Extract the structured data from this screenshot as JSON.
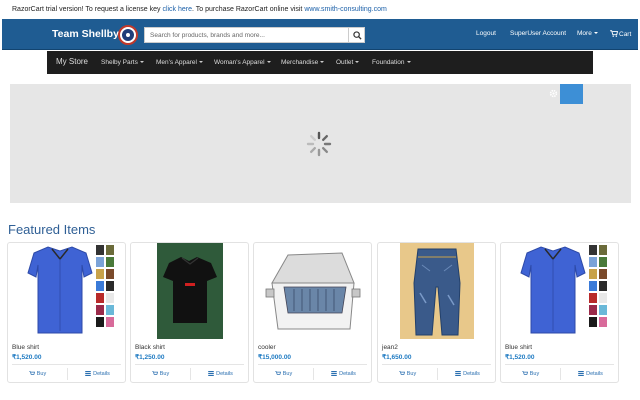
{
  "trial_bar": {
    "text_before": "RazorCart trial version! To request a license key ",
    "link1": "click here",
    "text_middle": ". To purchase RazorCart online visit ",
    "link2": "www.smith-consulting.com"
  },
  "header": {
    "brand": "Team Shellby",
    "search_placeholder": "Search for products, brands and more...",
    "logout": "Logout",
    "account": "SuperUser Account",
    "more": "More",
    "cart": "Cart"
  },
  "category_nav": {
    "store": "My Store",
    "items": [
      "Shelby Parts",
      "Men's Apparel",
      "Woman's Apparel",
      "Merchandise",
      "Outlet",
      "Foundation"
    ]
  },
  "featured": {
    "heading": "Featured Items",
    "products": [
      {
        "name": "Blue shirt",
        "price": "₹1,520.00",
        "buy": "Buy",
        "details": "Details"
      },
      {
        "name": "Black shirt",
        "price": "₹1,250.00",
        "buy": "Buy",
        "details": "Details"
      },
      {
        "name": "cooler",
        "price": "₹15,000.00",
        "buy": "Buy",
        "details": "Details"
      },
      {
        "name": "jean2",
        "price": "₹1,650.00",
        "buy": "Buy",
        "details": "Details"
      },
      {
        "name": "Blue shirt",
        "price": "₹1,520.00",
        "buy": "Buy",
        "details": "Details"
      }
    ]
  },
  "colors": {
    "header_bg": "#1f5c92",
    "category_bg": "#1e1e1e",
    "accent": "#3d8fd6",
    "price": "#1e7ac2",
    "heading": "#2f5f95"
  },
  "icons": {
    "search": "search-icon",
    "cart": "cart-icon",
    "gear": "gear-icon",
    "loading": "loading-spinner-icon",
    "buy": "cart-icon",
    "details": "list-icon"
  }
}
